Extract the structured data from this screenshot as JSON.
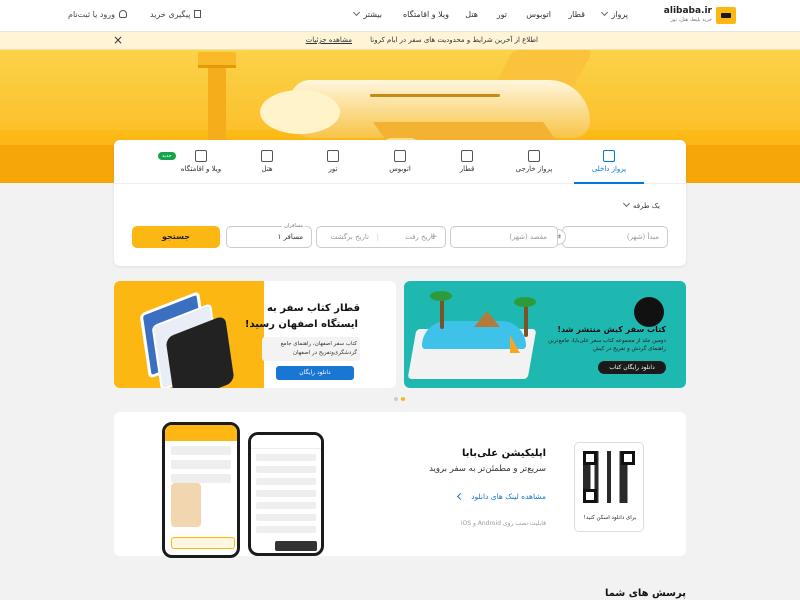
{
  "header": {
    "logo_brand": "alibaba.ir",
    "logo_tagline": "خرید بلیط، هتل، تور",
    "nav": [
      "پرواز",
      "قطار",
      "اتوبوس",
      "تور",
      "هتل",
      "ویلا و اقامتگاه",
      "بیشتر"
    ],
    "track_order": "پیگیری خرید",
    "login": "ورود یا ثبت‌نام"
  },
  "notice": {
    "text": "اطلاع از آخرین شرایط و محدودیت های سفر در ایام کرونا",
    "link": "مشاهده جزئیات",
    "close": "×"
  },
  "search": {
    "tabs": [
      {
        "label": "پرواز داخلی",
        "icon": "plane-icon",
        "active": true
      },
      {
        "label": "پرواز خارجی",
        "icon": "plane-globe-icon",
        "active": false
      },
      {
        "label": "قطار",
        "icon": "train-icon",
        "active": false
      },
      {
        "label": "اتوبوس",
        "icon": "bus-icon",
        "active": false
      },
      {
        "label": "تور",
        "icon": "tour-icon",
        "active": false
      },
      {
        "label": "هتل",
        "icon": "hotel-icon",
        "active": false
      },
      {
        "label": "ویلا و اقامتگاه",
        "icon": "villa-icon",
        "active": false,
        "badge": "جدید"
      }
    ],
    "trip_type": "یک طرفه",
    "origin_placeholder": "مبدأ (شهر)",
    "destination_placeholder": "مقصد (شهر)",
    "depart_placeholder": "تاریخ رفت",
    "return_placeholder": "تاریخ برگشت",
    "passengers_label": "مسافران",
    "passengers_value": "۱ مسافر",
    "search_button": "جستجو",
    "accent_color": "#0077db",
    "button_color": "#fdb713"
  },
  "promos": [
    {
      "title_line1": "قطار کتاب سفر به",
      "title_line2": "ایستگاه اصفهان رسید!",
      "body": "کتاب سفر اصفهان، راهنمای جامع گردشگری‌وتفریح در اصفهان",
      "button": "دانلود رایگان"
    },
    {
      "title": "کتاب سفر کیش منتشر شد!",
      "body": "دومین جلد از مجموعه کتاب سفر علی‌بابا، جامع‌ترین راهنمای گردش و تفریح در کیش",
      "button": "دانلود رایگان کتاب"
    }
  ],
  "carousel": {
    "count": 2,
    "active": 1
  },
  "app_section": {
    "title": "اپلیکیشن علی‌بابا",
    "subtitle": "سریع‌تر و مطمئن‌تر به سفر بروید",
    "link": "مشاهده لینک های دانلود",
    "platforms": "قابلیت نصب روی Android و iOS",
    "qr_caption": "برای دانلود اسکن کنید!"
  },
  "faq_title": "پرسش های شما"
}
